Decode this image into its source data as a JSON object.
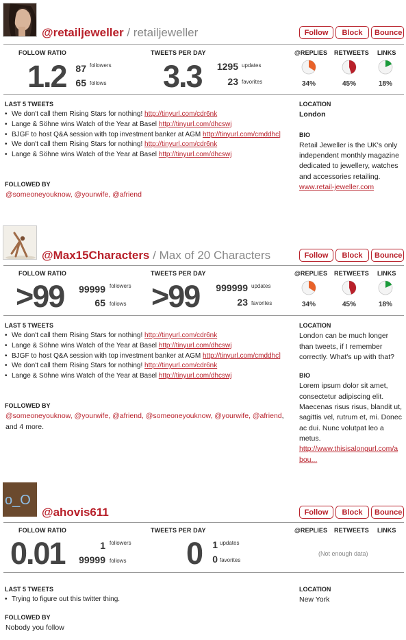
{
  "labels": {
    "follow_ratio": "FOLLOW RATIO",
    "tweets_per_day": "TWEETS PER DAY",
    "replies": "@REPLIES",
    "retweets": "RETWEETS",
    "links": "LINKS",
    "followers": "followers",
    "follows": "follows",
    "updates": "updates",
    "favorites": "favorites",
    "last_5_tweets": "LAST 5 TWEETS",
    "followed_by": "FOLLOWED BY",
    "location": "LOCATION",
    "bio": "BIO",
    "name_separator": "/"
  },
  "buttons": {
    "follow": "Follow",
    "block": "Block",
    "bounce": "Bounce"
  },
  "colors": {
    "accent": "#b8202a",
    "replies_pie": "#e8622a",
    "retweets_pie": "#b8202a",
    "links_pie": "#1a9a3a"
  },
  "profiles": [
    {
      "handle": "@retailjeweller",
      "full_name": "retailjeweller",
      "avatar_icon": "woman-portrait-photo",
      "follow_ratio": "1.2",
      "followers": "87",
      "follows": "65",
      "tweets_per_day": "3.3",
      "updates": "1295",
      "favorites": "23",
      "replies_pct": "34%",
      "replies_value": 0.34,
      "retweets_pct": "45%",
      "retweets_value": 0.45,
      "links_pct": "18%",
      "links_value": 0.18,
      "tweets": [
        {
          "text": "We don't call them Rising Stars for nothing! ",
          "link": "http://tinyurl.com/cdr6nk"
        },
        {
          "text": "Lange & Söhne wins Watch of the Year at Basel ",
          "link": "http://tinyurl.com/dhcswj"
        },
        {
          "text": "BJGF to host Q&A session with top investment banker at AGM ",
          "link": "http://tinyurl.com/cmddhc]"
        },
        {
          "text": "We don't call them Rising Stars for nothing! ",
          "link": "http://tinyurl.com/cdr6nk"
        },
        {
          "text": "Lange & Söhne wins Watch of the Year at Basel ",
          "link": "http://tinyurl.com/dhcswj"
        }
      ],
      "followed_by": "@someoneyouknow, @yourwife, @afriend",
      "location": "London",
      "bio": "Retail Jeweller is the UK's only independent monthly magazine dedicated to jewellery, watches and accessories retailing.",
      "bio_link": "www.retail-jeweller.com"
    },
    {
      "handle": "@Max15Characters",
      "full_name": "Max of 20 Characters",
      "avatar_icon": "yoga-pose-photo",
      "follow_ratio": ">99",
      "followers": "99999",
      "follows": "65",
      "tweets_per_day": ">99",
      "updates": "999999",
      "favorites": "23",
      "replies_pct": "34%",
      "replies_value": 0.34,
      "retweets_pct": "45%",
      "retweets_value": 0.45,
      "links_pct": "18%",
      "links_value": 0.18,
      "tweets": [
        {
          "text": "We don't call them Rising Stars for nothing! ",
          "link": "http://tinyurl.com/cdr6nk"
        },
        {
          "text": "Lange & Söhne wins Watch of the Year at Basel ",
          "link": "http://tinyurl.com/dhcswj"
        },
        {
          "text": "BJGF to host Q&A session with top investment banker at AGM ",
          "link": "http://tinyurl.com/cmddhc]"
        },
        {
          "text": "We don't call them Rising Stars for nothing! ",
          "link": "http://tinyurl.com/cdr6nk"
        },
        {
          "text": "Lange & Söhne wins Watch of the Year at Basel ",
          "link": "http://tinyurl.com/dhcswj"
        }
      ],
      "followed_by": "@someoneyouknow, @yourwife, @afriend, @someoneyouknow, @yourwife, @afriend",
      "followed_by_more": ", and 4 more.",
      "location": "London can be much longer than tweets, if I remember correctly. What's up with that?",
      "bio": "Lorem ipsum dolor sit amet, consectetur adipiscing elit. Maecenas risus risus, blandit ut, sagittis vel, rutrum et, mi. Donec ac dui. Nunc volutpat leo a metus.",
      "bio_link": "http://www.thisisalongurl.com/abou..."
    },
    {
      "handle": "@ahovis611",
      "avatar_text": "o_O",
      "follow_ratio": "0.01",
      "followers": "1",
      "follows": "99999",
      "tweets_per_day": "0",
      "updates": "1",
      "favorites": "0",
      "not_enough_data": "(Not enough data)",
      "tweets": [
        {
          "text": "Trying to figure out this twitter thing.",
          "link": ""
        }
      ],
      "followed_by": "Nobody you follow",
      "location": "New York"
    }
  ]
}
